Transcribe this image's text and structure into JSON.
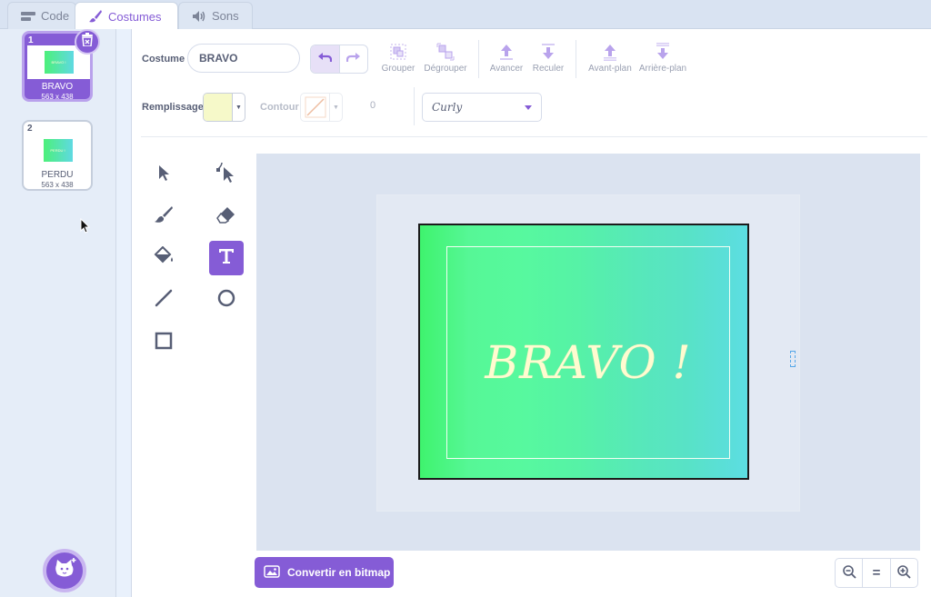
{
  "tabs": [
    {
      "label": "Code",
      "icon": "code-blocks-icon"
    },
    {
      "label": "Costumes",
      "icon": "paintbrush-icon",
      "active": true
    },
    {
      "label": "Sons",
      "icon": "speaker-icon"
    }
  ],
  "costumes": [
    {
      "number": "1",
      "name": "BRAVO",
      "size": "563 x 438",
      "thumb_text": "BRAVO !",
      "selected": true
    },
    {
      "number": "2",
      "name": "PERDU",
      "size": "563 x 438",
      "thumb_text": "PERDU !",
      "selected": false
    }
  ],
  "toolbar": {
    "costume_label": "Costume",
    "costume_name": "BRAVO",
    "group": "Grouper",
    "ungroup": "Dégrouper",
    "forward": "Avancer",
    "backward": "Reculer",
    "front": "Avant-plan",
    "back": "Arrière-plan",
    "fill_label": "Remplissage",
    "outline_label": "Contour",
    "outline_width": "0",
    "font": "Curly"
  },
  "colors": {
    "accent": "#855cd6",
    "fill": "#f6f9c9"
  },
  "canvas": {
    "text": "BRAVO !"
  },
  "footer": {
    "convert_label": "Convertir en bitmap",
    "zoom_reset": "="
  }
}
